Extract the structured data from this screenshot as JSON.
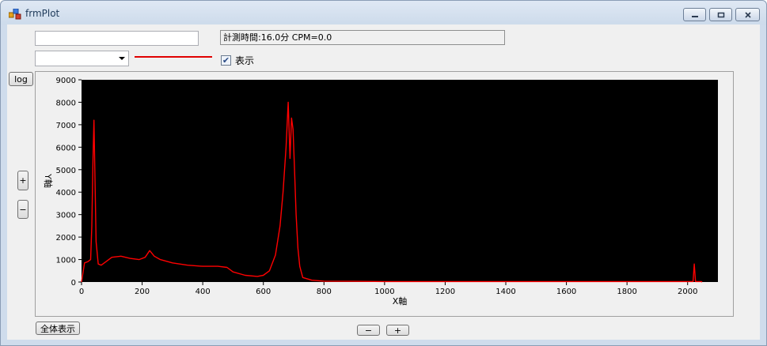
{
  "window": {
    "title": "frmPlot",
    "icons": {
      "app": "app-icon",
      "minimize": "minimize-icon",
      "maximize": "maximize-icon",
      "close": "close-icon"
    }
  },
  "controls": {
    "name_input_value": "",
    "status_text": "計測時間:16.0分  CPM=0.0",
    "combo_value": "",
    "series_color": "#e00000",
    "show_checkbox": {
      "label": "表示",
      "checked": true
    },
    "log_button": "log",
    "zoom_in_y": "+",
    "zoom_out_y": "−",
    "show_all_button": "全体表示",
    "zoom_out_x": "−",
    "zoom_in_x": "+"
  },
  "chart_data": {
    "type": "line",
    "xlabel": "X軸",
    "ylabel": "Y軸",
    "xlim": [
      0,
      2100
    ],
    "ylim": [
      0,
      9000
    ],
    "xticks": [
      0,
      200,
      400,
      600,
      800,
      1000,
      1200,
      1400,
      1600,
      1800,
      2000
    ],
    "yticks": [
      0,
      1000,
      2000,
      3000,
      4000,
      5000,
      6000,
      7000,
      8000,
      9000
    ],
    "background": "#000000",
    "line_color": "#ff0000",
    "series": [
      {
        "x": [
          0,
          10,
          20,
          30,
          34,
          38,
          41,
          44,
          48,
          55,
          65,
          80,
          100,
          130,
          160,
          190,
          210,
          225,
          240,
          260,
          300,
          350,
          400,
          450,
          480,
          500,
          540,
          580,
          600,
          620,
          640,
          655,
          665,
          675,
          682,
          688,
          693,
          698,
          703,
          708,
          714,
          720,
          730,
          760,
          800,
          900,
          1000,
          1200,
          1400,
          1600,
          1800,
          2000,
          2018,
          2022,
          2026,
          2035,
          2045,
          2048
        ],
        "y": [
          0,
          850,
          900,
          1000,
          2500,
          5500,
          7200,
          5000,
          1800,
          800,
          750,
          900,
          1100,
          1150,
          1050,
          1000,
          1100,
          1400,
          1150,
          1000,
          850,
          750,
          700,
          700,
          650,
          450,
          300,
          250,
          300,
          500,
          1200,
          2500,
          4000,
          6000,
          8000,
          5500,
          7300,
          6800,
          5000,
          3000,
          1500,
          700,
          200,
          80,
          40,
          30,
          20,
          20,
          20,
          20,
          20,
          20,
          20,
          800,
          20,
          20,
          20,
          0
        ]
      }
    ]
  }
}
